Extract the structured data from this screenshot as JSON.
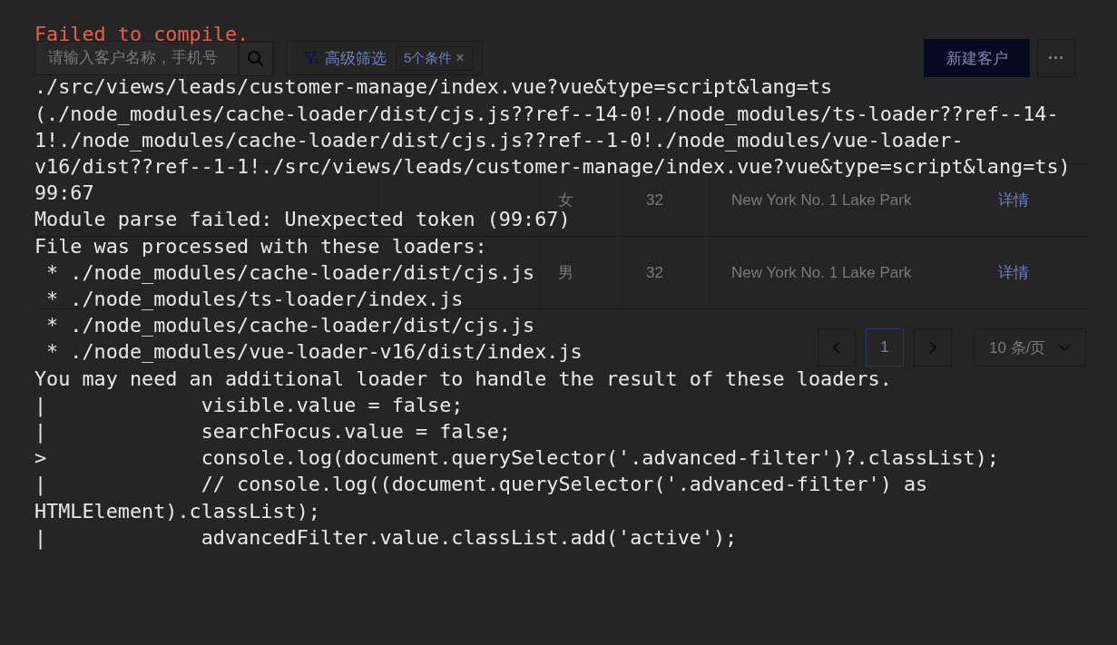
{
  "app": {
    "toolbar": {
      "search": {
        "placeholder": "请输入客户名称，手机号"
      },
      "filter_button": "高级筛选",
      "filter_tag": {
        "label": "5个条件",
        "close": "×"
      },
      "new_button": "新建客户",
      "more_button": "···"
    },
    "table": {
      "rows": [
        {
          "gender": "女",
          "age": "32",
          "city": "New York No. 1 Lake Park",
          "action": "详情"
        },
        {
          "gender": "男",
          "age": "32",
          "city": "New York No. 1 Lake Park",
          "action": "详情"
        }
      ]
    },
    "footer": {
      "pages": [
        {
          "label": "1",
          "selected": true
        }
      ],
      "page_size": "10 条/页"
    }
  },
  "error_overlay": {
    "title": "Failed to compile.",
    "lines": [
      "./src/views/leads/customer-manage/index.vue?vue&type=script&lang=ts",
      "(./node_modules/cache-loader/dist/cjs.js??ref--14-0!./node_modules/ts-loader??ref--14-",
      "1!./node_modules/cache-loader/dist/cjs.js??ref--1-0!./node_modules/vue-loader-",
      "v16/dist??ref--1-1!./src/views/leads/customer-manage/index.vue?vue&type=script&lang=ts)",
      "99:67",
      "Module parse failed: Unexpected token (99:67)",
      "File was processed with these loaders:",
      " * ./node_modules/cache-loader/dist/cjs.js",
      " * ./node_modules/ts-loader/index.js",
      " * ./node_modules/cache-loader/dist/cjs.js",
      " * ./node_modules/vue-loader-v16/dist/index.js",
      "You may need an additional loader to handle the result of these loaders.",
      "|             visible.value = false;",
      "|             searchFocus.value = false;",
      ">             console.log(document.querySelector('.advanced-filter')?.classList);",
      "|             // console.log((document.querySelector('.advanced-filter') as",
      "HTMLElement).classList);",
      "|             advancedFilter.value.classList.add('active');"
    ]
  }
}
